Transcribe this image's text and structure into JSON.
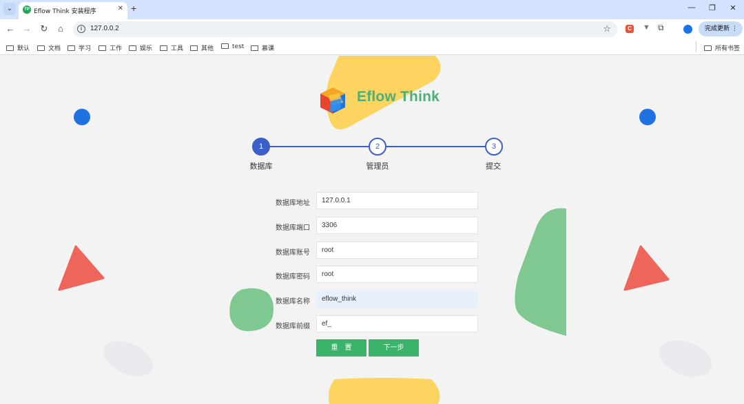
{
  "browser": {
    "tab_title": "Eflow Think 安装程序",
    "tab_favicon_text": "TP",
    "url": "127.0.0.2",
    "ext_letter": "C",
    "update_label": "完成更新 ⋮",
    "bookmarks": [
      "默认",
      "文档",
      "学习",
      "工作",
      "娱乐",
      "工具",
      "其他",
      "test",
      "慕课"
    ],
    "all_bookmarks": "所有书签"
  },
  "brand": {
    "name": "Eflow Think"
  },
  "steps": [
    {
      "number": "1",
      "label": "数据库"
    },
    {
      "number": "2",
      "label": "管理员"
    },
    {
      "number": "3",
      "label": "提交"
    }
  ],
  "form": {
    "fields": [
      {
        "label": "数据库地址",
        "value": "127.0.0.1"
      },
      {
        "label": "数据库端口",
        "value": "3306"
      },
      {
        "label": "数据库账号",
        "value": "root"
      },
      {
        "label": "数据库密码",
        "value": "root"
      },
      {
        "label": "数据库名称",
        "value": "eflow_think"
      },
      {
        "label": "数据库前缀",
        "value": "ef_"
      }
    ],
    "reset_label": "重　置",
    "next_label": "下一步"
  },
  "colors": {
    "accent": "#3a5fc6",
    "brand_green": "#4caf78",
    "button_green": "#3cb36a"
  },
  "icons": [
    "tab-search-icon",
    "back-arrow-icon",
    "forward-arrow-icon",
    "reload-icon",
    "home-icon",
    "site-info-icon",
    "bookmark-star-icon",
    "extensions-icon",
    "profile-icon",
    "folder-icon"
  ]
}
